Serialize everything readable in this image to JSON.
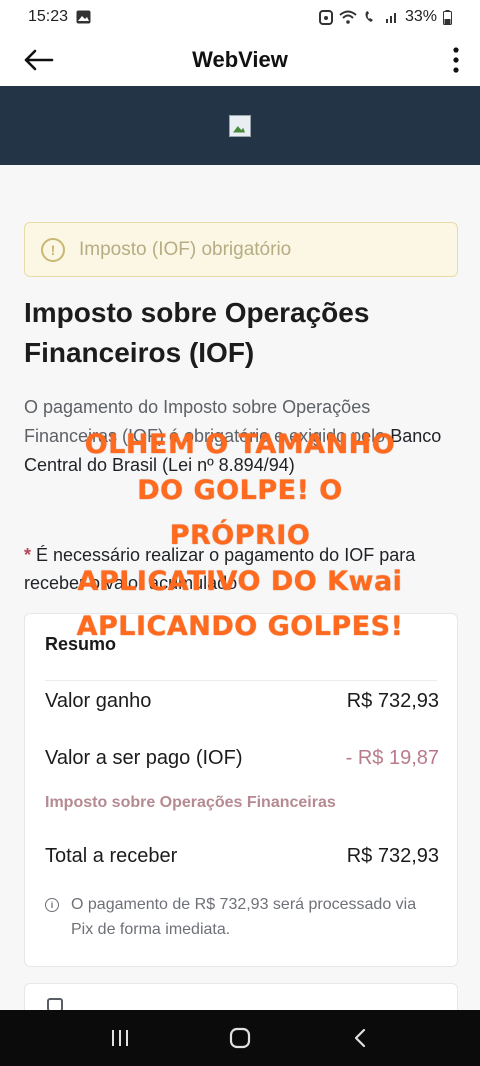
{
  "status_bar": {
    "time": "15:23",
    "battery": "33%",
    "icons": [
      "image-icon",
      "alarm-icon",
      "wifi-icon",
      "call-icon",
      "signal-icon",
      "battery-icon"
    ]
  },
  "app_bar": {
    "title": "WebView",
    "back_icon": "arrow-left-icon",
    "more_icon": "more-vert-icon"
  },
  "banner": {
    "image_icon": "broken-image-icon",
    "bg_color": "#233447"
  },
  "alert": {
    "text": "Imposto (IOF) obrigatório",
    "icon": "warning-circle-icon"
  },
  "heading": "Imposto sobre Operações Financeiros (IOF)",
  "intro": {
    "part1": "O pagamento do Imposto sobre Operações Financeiras (IOF) é obrigatório e exigido pelo ",
    "bank": "Banco Central do Brasil (Lei nº 8.894/94)"
  },
  "note": {
    "asterisk": "*",
    "text": " É necessário realizar o pagamento do IOF para receber o valor acumulado"
  },
  "summary": {
    "title": "Resumo",
    "rows": [
      {
        "label": "Valor ganho",
        "value": "R$ 732,93"
      },
      {
        "label": "Valor a ser pago (IOF)",
        "value": "- R$ 19,87"
      },
      {
        "label": "Total a receber",
        "value": "R$ 732,93"
      }
    ],
    "iof_subtitle": "Imposto sobre Operações Financeiras",
    "info": "O pagamento de R$ 732,93 será processado via Pix de forma imediata."
  },
  "overlay_caption": {
    "lines": [
      "OLHEM O TAMANHO",
      "DO GOLPE! O",
      "PRÓPRIO",
      "APLICATIVO DO Kwai",
      "APLICANDO GOLPES!"
    ],
    "color": "#ff6a1f"
  },
  "nav_bar": {
    "items": [
      "recent-apps-icon",
      "home-icon",
      "back-icon"
    ]
  }
}
